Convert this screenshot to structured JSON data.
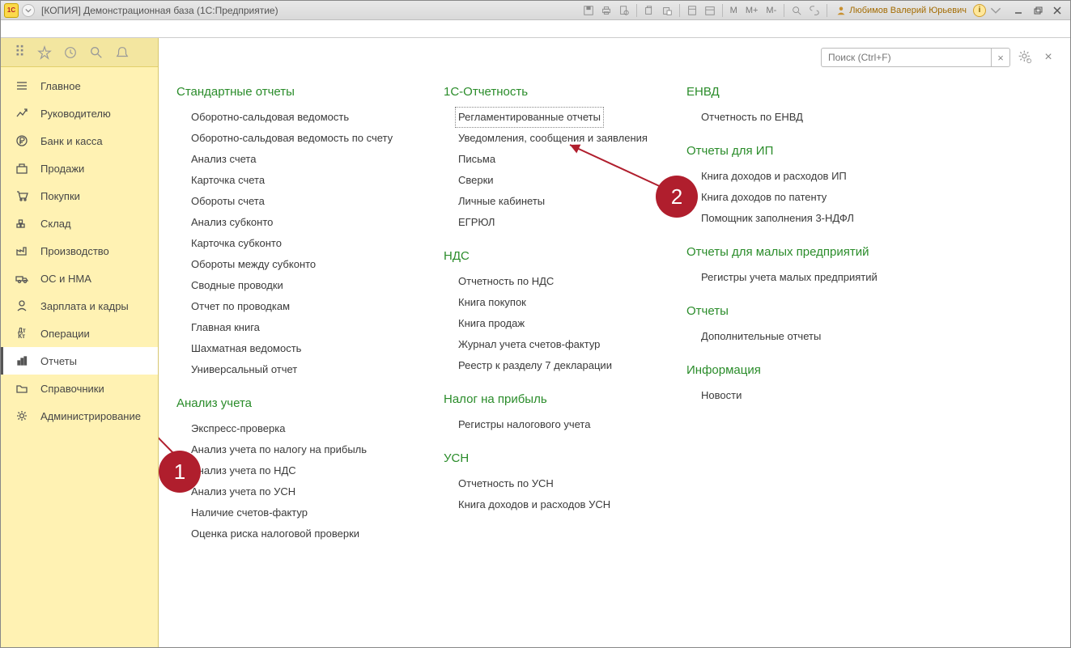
{
  "titlebar": {
    "logo_text": "1C",
    "title": "[КОПИЯ] Демонстрационная база  (1С:Предприятие)",
    "m_buttons": [
      "M",
      "M+",
      "M-"
    ],
    "user_name": "Любимов Валерий Юрьевич",
    "info": "i"
  },
  "lefttools": {},
  "nav": [
    {
      "id": "main",
      "label": "Главное",
      "icon": "menu"
    },
    {
      "id": "manager",
      "label": "Руководителю",
      "icon": "trend"
    },
    {
      "id": "bank",
      "label": "Банк и касса",
      "icon": "ruble"
    },
    {
      "id": "sales",
      "label": "Продажи",
      "icon": "box-out"
    },
    {
      "id": "purchases",
      "label": "Покупки",
      "icon": "cart"
    },
    {
      "id": "warehouse",
      "label": "Склад",
      "icon": "warehouse"
    },
    {
      "id": "production",
      "label": "Производство",
      "icon": "factory"
    },
    {
      "id": "assets",
      "label": "ОС и НМА",
      "icon": "truck"
    },
    {
      "id": "payroll",
      "label": "Зарплата и кадры",
      "icon": "person"
    },
    {
      "id": "operations",
      "label": "Операции",
      "icon": "dtkt"
    },
    {
      "id": "reports",
      "label": "Отчеты",
      "icon": "chart",
      "active": true
    },
    {
      "id": "directories",
      "label": "Справочники",
      "icon": "folder"
    },
    {
      "id": "admin",
      "label": "Администрирование",
      "icon": "gear"
    }
  ],
  "search": {
    "placeholder": "Поиск (Ctrl+F)",
    "clear": "×"
  },
  "close_panel": "×",
  "columns": [
    [
      {
        "title": "Стандартные отчеты",
        "items": [
          "Оборотно-сальдовая ведомость",
          "Оборотно-сальдовая ведомость по счету",
          "Анализ счета",
          "Карточка счета",
          "Обороты счета",
          "Анализ субконто",
          "Карточка субконто",
          "Обороты между субконто",
          "Сводные проводки",
          "Отчет по проводкам",
          "Главная книга",
          "Шахматная ведомость",
          "Универсальный отчет"
        ]
      },
      {
        "title": "Анализ учета",
        "items": [
          "Экспресс-проверка",
          "Анализ учета по налогу на прибыль",
          "Анализ учета по НДС",
          "Анализ учета по УСН",
          "Наличие счетов-фактур",
          "Оценка риска налоговой проверки"
        ]
      }
    ],
    [
      {
        "title": "1С-Отчетность",
        "items": [
          {
            "label": "Регламентированные отчеты",
            "boxed": true
          },
          "Уведомления, сообщения и заявления",
          "Письма",
          "Сверки",
          "Личные кабинеты",
          "ЕГРЮЛ"
        ]
      },
      {
        "title": "НДС",
        "items": [
          "Отчетность по НДС",
          "Книга покупок",
          "Книга продаж",
          "Журнал учета счетов-фактур",
          "Реестр к разделу 7 декларации"
        ]
      },
      {
        "title": "Налог на прибыль",
        "items": [
          "Регистры налогового учета"
        ]
      },
      {
        "title": "УСН",
        "items": [
          "Отчетность по УСН",
          "Книга доходов и расходов УСН"
        ]
      }
    ],
    [
      {
        "title": "ЕНВД",
        "items": [
          "Отчетность по ЕНВД"
        ]
      },
      {
        "title": "Отчеты для ИП",
        "items": [
          "Книга доходов и расходов ИП",
          "Книга доходов по патенту",
          "Помощник заполнения 3-НДФЛ"
        ]
      },
      {
        "title": "Отчеты для малых предприятий",
        "items": [
          "Регистры учета малых предприятий"
        ]
      },
      {
        "title": "Отчеты",
        "items": [
          "Дополнительные отчеты"
        ]
      },
      {
        "title": "Информация",
        "items": [
          "Новости"
        ]
      }
    ]
  ],
  "callouts": {
    "c1": "1",
    "c2": "2"
  }
}
